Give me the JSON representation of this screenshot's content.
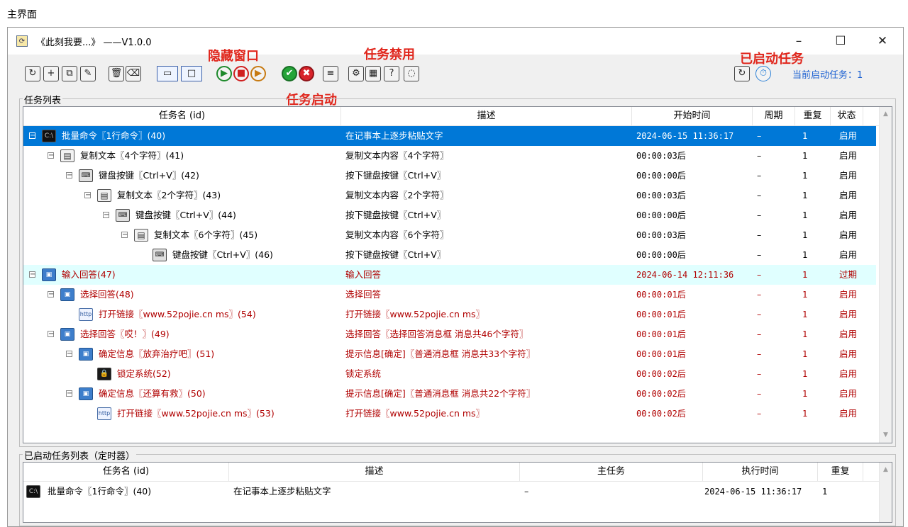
{
  "caption": "主界面",
  "window": {
    "title": "《此刻我要...》  ——V1.0.0",
    "minimize": "–",
    "maximize": "☐",
    "close": "✕"
  },
  "toolbar": {
    "buttons": [
      {
        "name": "refresh-icon",
        "glyph": "↻"
      },
      {
        "name": "add-task-icon",
        "glyph": "+"
      },
      {
        "name": "copy-task-icon",
        "glyph": "⧉"
      },
      {
        "name": "edit-task-icon",
        "glyph": "✎"
      },
      {
        "name": "delete-icon",
        "glyph": "🗑"
      },
      {
        "name": "clear-icon",
        "glyph": "⌫"
      },
      {
        "name": "hide-window-icon",
        "glyph": "▭"
      },
      {
        "name": "show-window-icon",
        "glyph": "□"
      },
      {
        "name": "start-icon",
        "glyph": "▶"
      },
      {
        "name": "stop-icon",
        "glyph": "■"
      },
      {
        "name": "next-icon",
        "glyph": "▶"
      },
      {
        "name": "enable-icon",
        "glyph": "✔"
      },
      {
        "name": "disable-icon",
        "glyph": "✖"
      },
      {
        "name": "notes-icon",
        "glyph": "≡"
      },
      {
        "name": "settings-icon",
        "glyph": "⚙"
      },
      {
        "name": "calendar-icon",
        "glyph": "▦"
      },
      {
        "name": "help-icon",
        "glyph": "?"
      },
      {
        "name": "chat-icon",
        "glyph": "◌"
      }
    ],
    "right_buttons": [
      {
        "name": "reload-icon",
        "glyph": "↻"
      },
      {
        "name": "timer-icon",
        "glyph": "⏱"
      }
    ],
    "status": "当前启动任务：1"
  },
  "annotations": {
    "hide_window": "隐藏窗口",
    "task_start": "任务启动",
    "task_disable": "任务禁用",
    "started_tasks": "已启动任务"
  },
  "task_list": {
    "title": "任务列表",
    "columns": [
      "任务名 (id)",
      "描述",
      "开始时间",
      "周期",
      "重复",
      "状态"
    ],
    "rows": [
      {
        "indent": 0,
        "toggle": "⊟",
        "icon": "cmd",
        "glyph": "C:\\",
        "name": "批量命令〖1行命令〗(40)",
        "desc": "在记事本上逐步粘贴文字",
        "start": "2024-06-15 11:36:17",
        "period": "–",
        "repeat": "1",
        "status": "启用",
        "style": "selected"
      },
      {
        "indent": 1,
        "toggle": "⊟",
        "icon": "copy",
        "glyph": "▤",
        "name": "复制文本〖4个字符〗(41)",
        "desc": "复制文本内容〖4个字符〗",
        "start": "00:00:03后",
        "period": "–",
        "repeat": "1",
        "status": "启用",
        "style": ""
      },
      {
        "indent": 2,
        "toggle": "⊟",
        "icon": "kbd",
        "glyph": "⌨",
        "name": "键盘按键〖Ctrl+V〗(42)",
        "desc": "按下键盘按键〖Ctrl+V〗",
        "start": "00:00:00后",
        "period": "–",
        "repeat": "1",
        "status": "启用",
        "style": ""
      },
      {
        "indent": 3,
        "toggle": "⊟",
        "icon": "copy",
        "glyph": "▤",
        "name": "复制文本〖2个字符〗(43)",
        "desc": "复制文本内容〖2个字符〗",
        "start": "00:00:03后",
        "period": "–",
        "repeat": "1",
        "status": "启用",
        "style": ""
      },
      {
        "indent": 4,
        "toggle": "⊟",
        "icon": "kbd",
        "glyph": "⌨",
        "name": "键盘按键〖Ctrl+V〗(44)",
        "desc": "按下键盘按键〖Ctrl+V〗",
        "start": "00:00:00后",
        "period": "–",
        "repeat": "1",
        "status": "启用",
        "style": ""
      },
      {
        "indent": 5,
        "toggle": "⊟",
        "icon": "copy",
        "glyph": "▤",
        "name": "复制文本〖6个字符〗(45)",
        "desc": "复制文本内容〖6个字符〗",
        "start": "00:00:03后",
        "period": "–",
        "repeat": "1",
        "status": "启用",
        "style": ""
      },
      {
        "indent": 6,
        "toggle": "",
        "icon": "kbd",
        "glyph": "⌨",
        "name": "键盘按键〖Ctrl+V〗(46)",
        "desc": "按下键盘按键〖Ctrl+V〗",
        "start": "00:00:00后",
        "period": "–",
        "repeat": "1",
        "status": "启用",
        "style": ""
      },
      {
        "indent": 0,
        "toggle": "⊟",
        "icon": "dlg",
        "glyph": "▣",
        "name": "输入回答(47)",
        "desc": "输入回答",
        "start": "2024-06-14 12:11:36",
        "period": "–",
        "repeat": "1",
        "status": "过期",
        "style": "cyan red"
      },
      {
        "indent": 1,
        "toggle": "⊟",
        "icon": "dlg",
        "glyph": "▣",
        "name": "选择回答(48)",
        "desc": "选择回答",
        "start": "00:00:01后",
        "period": "–",
        "repeat": "1",
        "status": "启用",
        "style": "red"
      },
      {
        "indent": 2,
        "toggle": "",
        "icon": "link",
        "glyph": "http",
        "name": "打开链接〖www.52pojie.cn ms〗(54)",
        "desc": "打开链接〖www.52pojie.cn ms〗",
        "start": "00:00:01后",
        "period": "–",
        "repeat": "1",
        "status": "启用",
        "style": "red"
      },
      {
        "indent": 1,
        "toggle": "⊟",
        "icon": "dlg",
        "glyph": "▣",
        "name": "选择回答〖哎！〗(49)",
        "desc": "选择回答〖选择回答消息框 消息共46个字符〗",
        "start": "00:00:01后",
        "period": "–",
        "repeat": "1",
        "status": "启用",
        "style": "red"
      },
      {
        "indent": 2,
        "toggle": "⊟",
        "icon": "dlg",
        "glyph": "▣",
        "name": "确定信息〖放弃治疗吧〗(51)",
        "desc": "提示信息[确定]〖普通消息框 消息共33个字符〗",
        "start": "00:00:01后",
        "period": "–",
        "repeat": "1",
        "status": "启用",
        "style": "red"
      },
      {
        "indent": 3,
        "toggle": "",
        "icon": "lock",
        "glyph": "🔒",
        "name": "锁定系统(52)",
        "desc": "锁定系统",
        "start": "00:00:02后",
        "period": "–",
        "repeat": "1",
        "status": "启用",
        "style": "red"
      },
      {
        "indent": 2,
        "toggle": "⊟",
        "icon": "dlg",
        "glyph": "▣",
        "name": "确定信息〖还算有救〗(50)",
        "desc": "提示信息[确定]〖普通消息框 消息共22个字符〗",
        "start": "00:00:02后",
        "period": "–",
        "repeat": "1",
        "status": "启用",
        "style": "red"
      },
      {
        "indent": 3,
        "toggle": "",
        "icon": "link",
        "glyph": "http",
        "name": "打开链接〖www.52pojie.cn ms〗(53)",
        "desc": "打开链接〖www.52pojie.cn ms〗",
        "start": "00:00:02后",
        "period": "–",
        "repeat": "1",
        "status": "启用",
        "style": "red"
      }
    ]
  },
  "started_list": {
    "title": "已启动任务列表（定时器）",
    "columns": [
      "任务名 (id)",
      "描述",
      "主任务",
      "执行时间",
      "重复"
    ],
    "rows": [
      {
        "icon": "cmd",
        "glyph": "C:\\",
        "name": "批量命令〖1行命令〗(40)",
        "desc": "在记事本上逐步粘贴文字",
        "main": "–",
        "time": "2024-06-15 11:36:17",
        "repeat": "1"
      }
    ]
  }
}
